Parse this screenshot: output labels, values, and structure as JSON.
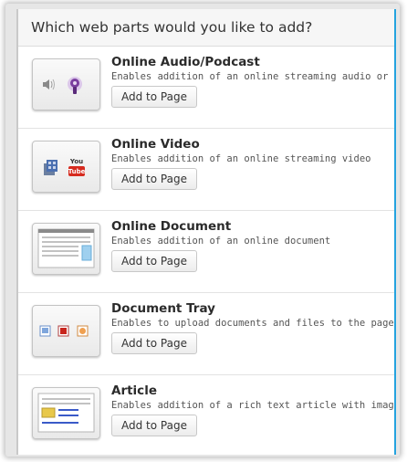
{
  "header": {
    "title": "Which web parts would you like to add?"
  },
  "parts": [
    {
      "title": "Online Audio/Podcast",
      "description": "Enables addition of an online streaming audio or podcast",
      "button_label": "Add to Page",
      "icon": "audio-podcast-icon"
    },
    {
      "title": "Online Video",
      "description": "Enables addition of an online streaming video",
      "button_label": "Add to Page",
      "icon": "video-icon",
      "icon_text": "You Tube"
    },
    {
      "title": "Online Document",
      "description": "Enables addition of an online document",
      "button_label": "Add to Page",
      "icon": "document-icon"
    },
    {
      "title": "Document Tray",
      "description": "Enables to upload documents and files to the page",
      "button_label": "Add to Page",
      "icon": "document-tray-icon"
    },
    {
      "title": "Article",
      "description": "Enables addition of a rich text article with images",
      "button_label": "Add to Page",
      "icon": "article-icon"
    }
  ],
  "colors": {
    "accent_border": "#24a3df",
    "podcast_purple": "#7b3fa0",
    "youtube_red": "#d62b1f"
  }
}
